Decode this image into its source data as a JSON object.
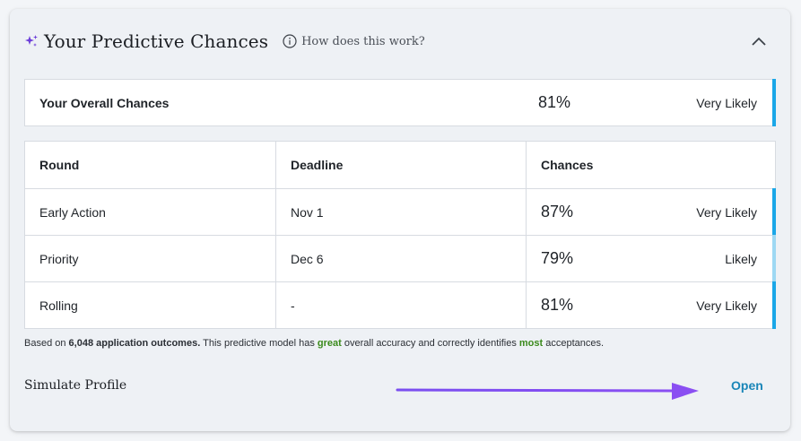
{
  "header": {
    "title": "Your Predictive Chances",
    "help_text": "How does this work?",
    "sparkle_icon": "sparkle-icon",
    "collapse_icon": "chevron-up-icon"
  },
  "overall": {
    "label": "Your Overall Chances",
    "percent": "81%",
    "likelihood": "Very Likely"
  },
  "table": {
    "headers": [
      "Round",
      "Deadline",
      "Chances"
    ],
    "rows": [
      {
        "round": "Early Action",
        "deadline": "Nov 1",
        "percent": "87%",
        "likelihood": "Very Likely"
      },
      {
        "round": "Priority",
        "deadline": "Dec 6",
        "percent": "79%",
        "likelihood": "Likely"
      },
      {
        "round": "Rolling",
        "deadline": "-",
        "percent": "81%",
        "likelihood": "Very Likely"
      }
    ]
  },
  "note": {
    "prefix": "Based on ",
    "outcomes": "6,048 application outcomes.",
    "middle1": " This predictive model has ",
    "accuracy": "great",
    "middle2": " overall accuracy and correctly identifies ",
    "identifies": "most",
    "suffix": " acceptances."
  },
  "simulate": {
    "label": "Simulate Profile",
    "open_label": "Open"
  },
  "colors": {
    "very_likely": "#1aa7e8",
    "likely": "#9dd8f3",
    "accent_purple": "#7c3aed",
    "green": "#3b8a1c",
    "link": "#1a86b8"
  }
}
